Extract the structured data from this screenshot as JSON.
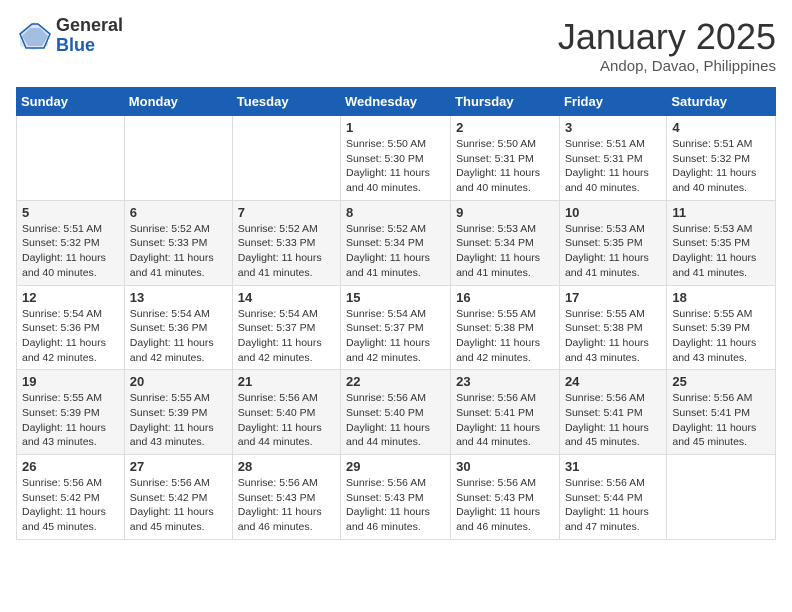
{
  "header": {
    "logo_general": "General",
    "logo_blue": "Blue",
    "month_title": "January 2025",
    "subtitle": "Andop, Davao, Philippines"
  },
  "days_of_week": [
    "Sunday",
    "Monday",
    "Tuesday",
    "Wednesday",
    "Thursday",
    "Friday",
    "Saturday"
  ],
  "weeks": [
    [
      {
        "num": "",
        "info": ""
      },
      {
        "num": "",
        "info": ""
      },
      {
        "num": "",
        "info": ""
      },
      {
        "num": "1",
        "info": "Sunrise: 5:50 AM\nSunset: 5:30 PM\nDaylight: 11 hours and 40 minutes."
      },
      {
        "num": "2",
        "info": "Sunrise: 5:50 AM\nSunset: 5:31 PM\nDaylight: 11 hours and 40 minutes."
      },
      {
        "num": "3",
        "info": "Sunrise: 5:51 AM\nSunset: 5:31 PM\nDaylight: 11 hours and 40 minutes."
      },
      {
        "num": "4",
        "info": "Sunrise: 5:51 AM\nSunset: 5:32 PM\nDaylight: 11 hours and 40 minutes."
      }
    ],
    [
      {
        "num": "5",
        "info": "Sunrise: 5:51 AM\nSunset: 5:32 PM\nDaylight: 11 hours and 40 minutes."
      },
      {
        "num": "6",
        "info": "Sunrise: 5:52 AM\nSunset: 5:33 PM\nDaylight: 11 hours and 41 minutes."
      },
      {
        "num": "7",
        "info": "Sunrise: 5:52 AM\nSunset: 5:33 PM\nDaylight: 11 hours and 41 minutes."
      },
      {
        "num": "8",
        "info": "Sunrise: 5:52 AM\nSunset: 5:34 PM\nDaylight: 11 hours and 41 minutes."
      },
      {
        "num": "9",
        "info": "Sunrise: 5:53 AM\nSunset: 5:34 PM\nDaylight: 11 hours and 41 minutes."
      },
      {
        "num": "10",
        "info": "Sunrise: 5:53 AM\nSunset: 5:35 PM\nDaylight: 11 hours and 41 minutes."
      },
      {
        "num": "11",
        "info": "Sunrise: 5:53 AM\nSunset: 5:35 PM\nDaylight: 11 hours and 41 minutes."
      }
    ],
    [
      {
        "num": "12",
        "info": "Sunrise: 5:54 AM\nSunset: 5:36 PM\nDaylight: 11 hours and 42 minutes."
      },
      {
        "num": "13",
        "info": "Sunrise: 5:54 AM\nSunset: 5:36 PM\nDaylight: 11 hours and 42 minutes."
      },
      {
        "num": "14",
        "info": "Sunrise: 5:54 AM\nSunset: 5:37 PM\nDaylight: 11 hours and 42 minutes."
      },
      {
        "num": "15",
        "info": "Sunrise: 5:54 AM\nSunset: 5:37 PM\nDaylight: 11 hours and 42 minutes."
      },
      {
        "num": "16",
        "info": "Sunrise: 5:55 AM\nSunset: 5:38 PM\nDaylight: 11 hours and 42 minutes."
      },
      {
        "num": "17",
        "info": "Sunrise: 5:55 AM\nSunset: 5:38 PM\nDaylight: 11 hours and 43 minutes."
      },
      {
        "num": "18",
        "info": "Sunrise: 5:55 AM\nSunset: 5:39 PM\nDaylight: 11 hours and 43 minutes."
      }
    ],
    [
      {
        "num": "19",
        "info": "Sunrise: 5:55 AM\nSunset: 5:39 PM\nDaylight: 11 hours and 43 minutes."
      },
      {
        "num": "20",
        "info": "Sunrise: 5:55 AM\nSunset: 5:39 PM\nDaylight: 11 hours and 43 minutes."
      },
      {
        "num": "21",
        "info": "Sunrise: 5:56 AM\nSunset: 5:40 PM\nDaylight: 11 hours and 44 minutes."
      },
      {
        "num": "22",
        "info": "Sunrise: 5:56 AM\nSunset: 5:40 PM\nDaylight: 11 hours and 44 minutes."
      },
      {
        "num": "23",
        "info": "Sunrise: 5:56 AM\nSunset: 5:41 PM\nDaylight: 11 hours and 44 minutes."
      },
      {
        "num": "24",
        "info": "Sunrise: 5:56 AM\nSunset: 5:41 PM\nDaylight: 11 hours and 45 minutes."
      },
      {
        "num": "25",
        "info": "Sunrise: 5:56 AM\nSunset: 5:41 PM\nDaylight: 11 hours and 45 minutes."
      }
    ],
    [
      {
        "num": "26",
        "info": "Sunrise: 5:56 AM\nSunset: 5:42 PM\nDaylight: 11 hours and 45 minutes."
      },
      {
        "num": "27",
        "info": "Sunrise: 5:56 AM\nSunset: 5:42 PM\nDaylight: 11 hours and 45 minutes."
      },
      {
        "num": "28",
        "info": "Sunrise: 5:56 AM\nSunset: 5:43 PM\nDaylight: 11 hours and 46 minutes."
      },
      {
        "num": "29",
        "info": "Sunrise: 5:56 AM\nSunset: 5:43 PM\nDaylight: 11 hours and 46 minutes."
      },
      {
        "num": "30",
        "info": "Sunrise: 5:56 AM\nSunset: 5:43 PM\nDaylight: 11 hours and 46 minutes."
      },
      {
        "num": "31",
        "info": "Sunrise: 5:56 AM\nSunset: 5:44 PM\nDaylight: 11 hours and 47 minutes."
      },
      {
        "num": "",
        "info": ""
      }
    ]
  ]
}
